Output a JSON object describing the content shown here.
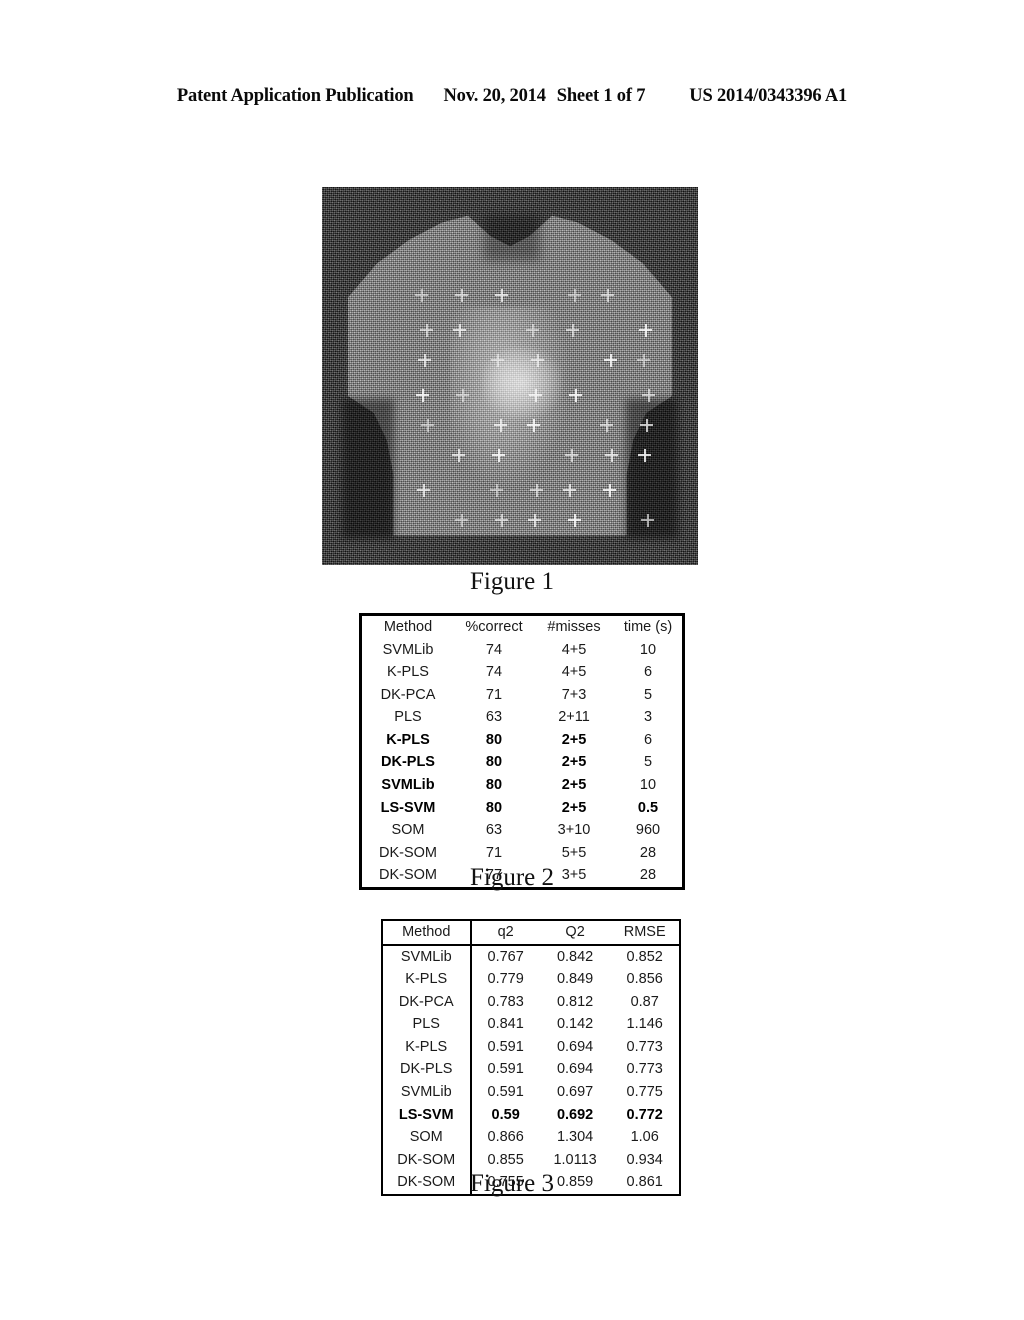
{
  "patent_header": {
    "publication": "Patent Application Publication",
    "date": "Nov. 20, 2014",
    "sheet": "Sheet 1 of 7",
    "doc_number": "US 2014/0343396 A1"
  },
  "figure1": {
    "caption": "Figure 1",
    "alt": "grayscale noisy thermal torso image with overlaid grid of cross markers"
  },
  "figure2": {
    "caption": "Figure 2",
    "headers": [
      "Method",
      "%correct",
      "#misses",
      "time (s)"
    ],
    "rows": [
      {
        "cells": [
          "SVMLib",
          "74",
          "4+5",
          "10"
        ],
        "bold": false,
        "time_bold": false
      },
      {
        "cells": [
          "K-PLS",
          "74",
          "4+5",
          "6"
        ],
        "bold": false,
        "time_bold": false
      },
      {
        "cells": [
          "DK-PCA",
          "71",
          "7+3",
          "5"
        ],
        "bold": false,
        "time_bold": false
      },
      {
        "cells": [
          "PLS",
          "63",
          "2+11",
          "3"
        ],
        "bold": false,
        "time_bold": false
      },
      {
        "cells": [
          "K-PLS",
          "80",
          "2+5",
          "6"
        ],
        "bold": true,
        "time_bold": false
      },
      {
        "cells": [
          "DK-PLS",
          "80",
          "2+5",
          "5"
        ],
        "bold": true,
        "time_bold": false
      },
      {
        "cells": [
          "SVMLib",
          "80",
          "2+5",
          "10"
        ],
        "bold": true,
        "time_bold": false
      },
      {
        "cells": [
          "LS-SVM",
          "80",
          "2+5",
          "0.5"
        ],
        "bold": true,
        "time_bold": true
      },
      {
        "cells": [
          "SOM",
          "63",
          "3+10",
          "960"
        ],
        "bold": false,
        "time_bold": false
      },
      {
        "cells": [
          "DK-SOM",
          "71",
          "5+5",
          "28"
        ],
        "bold": false,
        "time_bold": false
      },
      {
        "cells": [
          "DK-SOM",
          "77",
          "3+5",
          "28"
        ],
        "bold": false,
        "time_bold": false
      }
    ]
  },
  "figure3": {
    "caption": "Figure 3",
    "headers": [
      "Method",
      "q2",
      "Q2",
      "RMSE"
    ],
    "rows": [
      {
        "cells": [
          "SVMLib",
          "0.767",
          "0.842",
          "0.852"
        ],
        "bold": false
      },
      {
        "cells": [
          "K-PLS",
          "0.779",
          "0.849",
          "0.856"
        ],
        "bold": false
      },
      {
        "cells": [
          "DK-PCA",
          "0.783",
          "0.812",
          "0.87"
        ],
        "bold": false
      },
      {
        "cells": [
          "PLS",
          "0.841",
          "0.142",
          "1.146"
        ],
        "bold": false
      },
      {
        "cells": [
          "K-PLS",
          "0.591",
          "0.694",
          "0.773"
        ],
        "bold": false
      },
      {
        "cells": [
          "DK-PLS",
          "0.591",
          "0.694",
          "0.773"
        ],
        "bold": false
      },
      {
        "cells": [
          "SVMLib",
          "0.591",
          "0.697",
          "0.775"
        ],
        "bold": false
      },
      {
        "cells": [
          "LS-SVM",
          "0.59",
          "0.692",
          "0.772"
        ],
        "bold": true
      },
      {
        "cells": [
          "SOM",
          "0.866",
          "1.304",
          "1.06"
        ],
        "bold": false
      },
      {
        "cells": [
          "DK-SOM",
          "0.855",
          "1.0113",
          "0.934"
        ],
        "bold": false
      },
      {
        "cells": [
          "DK-SOM",
          "0.755",
          "0.859",
          "0.861"
        ],
        "bold": false
      }
    ]
  },
  "chart_data": [
    {
      "type": "table",
      "title": "Figure 2",
      "columns": [
        "Method",
        "%correct",
        "#misses",
        "time (s)"
      ],
      "rows": [
        [
          "SVMLib",
          74,
          "4+5",
          10
        ],
        [
          "K-PLS",
          74,
          "4+5",
          6
        ],
        [
          "DK-PCA",
          71,
          "7+3",
          5
        ],
        [
          "PLS",
          63,
          "2+11",
          3
        ],
        [
          "K-PLS",
          80,
          "2+5",
          6
        ],
        [
          "DK-PLS",
          80,
          "2+5",
          5
        ],
        [
          "SVMLib",
          80,
          "2+5",
          10
        ],
        [
          "LS-SVM",
          80,
          "2+5",
          0.5
        ],
        [
          "SOM",
          63,
          "3+10",
          960
        ],
        [
          "DK-SOM",
          71,
          "5+5",
          28
        ],
        [
          "DK-SOM",
          77,
          "3+5",
          28
        ]
      ],
      "emphasized_rows": [
        4,
        5,
        6,
        7
      ]
    },
    {
      "type": "table",
      "title": "Figure 3",
      "columns": [
        "Method",
        "q2",
        "Q2",
        "RMSE"
      ],
      "rows": [
        [
          "SVMLib",
          0.767,
          0.842,
          0.852
        ],
        [
          "K-PLS",
          0.779,
          0.849,
          0.856
        ],
        [
          "DK-PCA",
          0.783,
          0.812,
          0.87
        ],
        [
          "PLS",
          0.841,
          0.142,
          1.146
        ],
        [
          "K-PLS",
          0.591,
          0.694,
          0.773
        ],
        [
          "DK-PLS",
          0.591,
          0.694,
          0.773
        ],
        [
          "SVMLib",
          0.591,
          0.697,
          0.775
        ],
        [
          "LS-SVM",
          0.59,
          0.692,
          0.772
        ],
        [
          "SOM",
          0.866,
          1.304,
          1.06
        ],
        [
          "DK-SOM",
          0.855,
          1.0113,
          0.934
        ],
        [
          "DK-SOM",
          0.755,
          0.859,
          0.861
        ]
      ],
      "emphasized_rows": [
        7
      ]
    }
  ]
}
